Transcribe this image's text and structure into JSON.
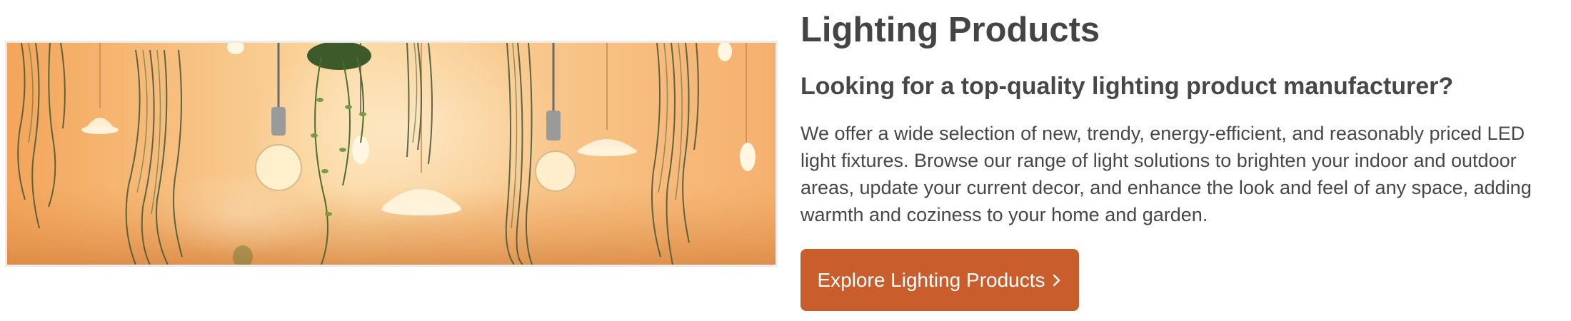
{
  "section": {
    "title": "Lighting Products",
    "subtitle": "Looking for a top-quality lighting product manufacturer?",
    "description": "We offer a wide selection of new, trendy, energy-efficient, and reasonably priced LED light fixtures. Browse our range of light solutions to brighten your indoor and outdoor areas, update your current decor, and enhance the look and feel of any space, adding warmth and coziness to your home and garden.",
    "cta_label": "Explore Lighting Products",
    "cta_icon": "chevron-right-icon"
  },
  "colors": {
    "button_background": "#c95d2c",
    "button_text": "#ffffff",
    "heading_text": "#444444",
    "body_text": "#474747"
  }
}
